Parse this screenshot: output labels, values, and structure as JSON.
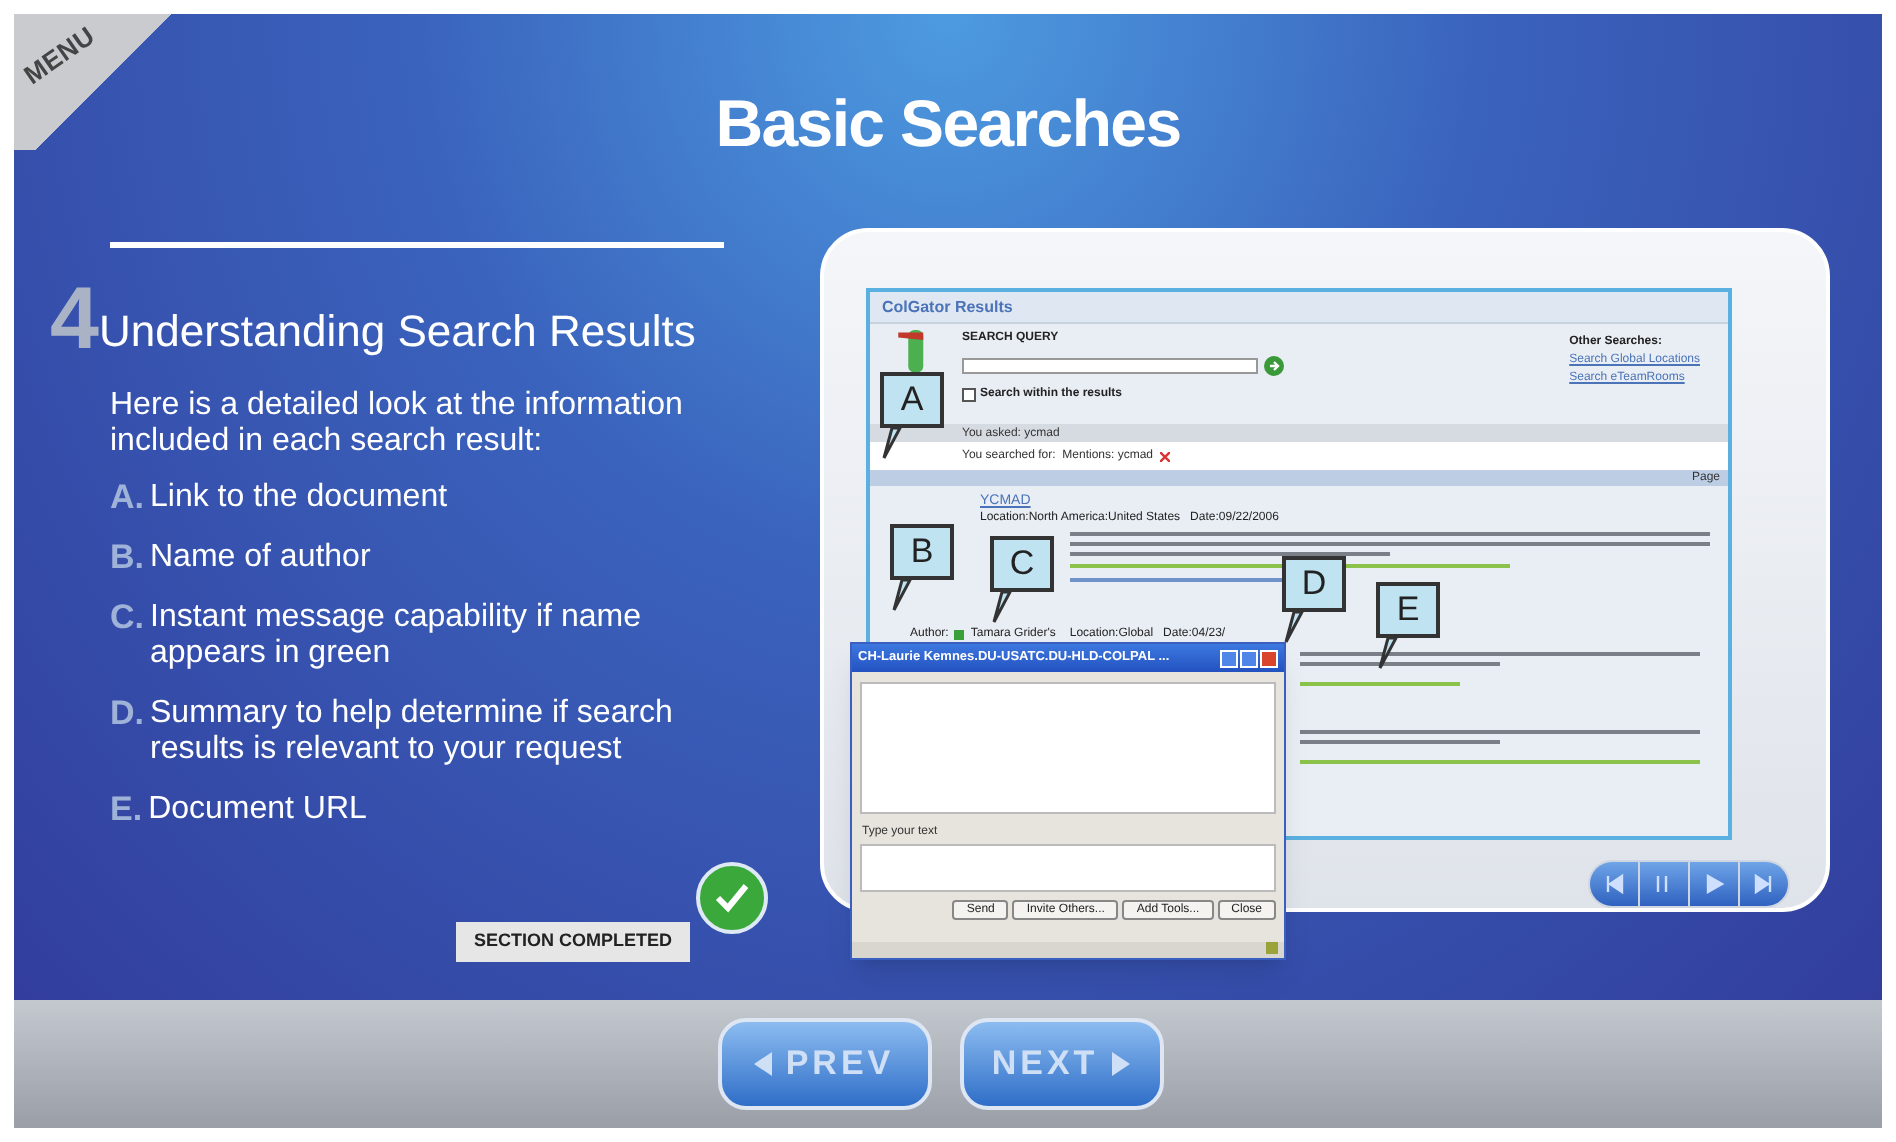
{
  "menu_label": "MENU",
  "title": "Basic Searches",
  "lesson": {
    "number": "4",
    "heading": "Understanding Search Results",
    "intro": "Here is a detailed look at the information included in each search result:",
    "items": [
      {
        "letter": "A.",
        "text": "Link to the document"
      },
      {
        "letter": "B.",
        "text": "Name of author"
      },
      {
        "letter": "C.",
        "text": "Instant message capability if name appears in green"
      },
      {
        "letter": "D.",
        "text": "Summary to help determine if search results is relevant to your request"
      },
      {
        "letter": "E.",
        "text": "Document URL"
      }
    ]
  },
  "section_status": {
    "label": "SECTION COMPLETED",
    "completed": true
  },
  "screenshot": {
    "app_title": "ColGator Results",
    "search_label": "SEARCH QUERY",
    "within_label": "Search within the results",
    "within_checked": false,
    "other_heading": "Other Searches:",
    "other_links": [
      "Search Global Locations",
      "Search eTeamRooms"
    ],
    "you_asked": "You asked: ycmad",
    "searched_for": "You searched for:  Mentions: ycmad",
    "page_label": "Page",
    "first_result": {
      "title": "YCMAD",
      "meta": "Location:North America:United States   Date:09/22/2006"
    },
    "second_result": {
      "author_label": "Author:",
      "author": "Tamara Grider's",
      "author_online": true,
      "meta": "Location:Global   Date:04/23/"
    }
  },
  "callouts": [
    "A",
    "B",
    "C",
    "D",
    "E"
  ],
  "chat": {
    "title": "CH-Laurie Kemnes.DU-USATC.DU-HLD-COLPAL ...",
    "prompt": "Type your text",
    "buttons": [
      "Send",
      "Invite Others...",
      "Add Tools...",
      "Close"
    ]
  },
  "nav": {
    "prev": "PREV",
    "next": "NEXT"
  }
}
